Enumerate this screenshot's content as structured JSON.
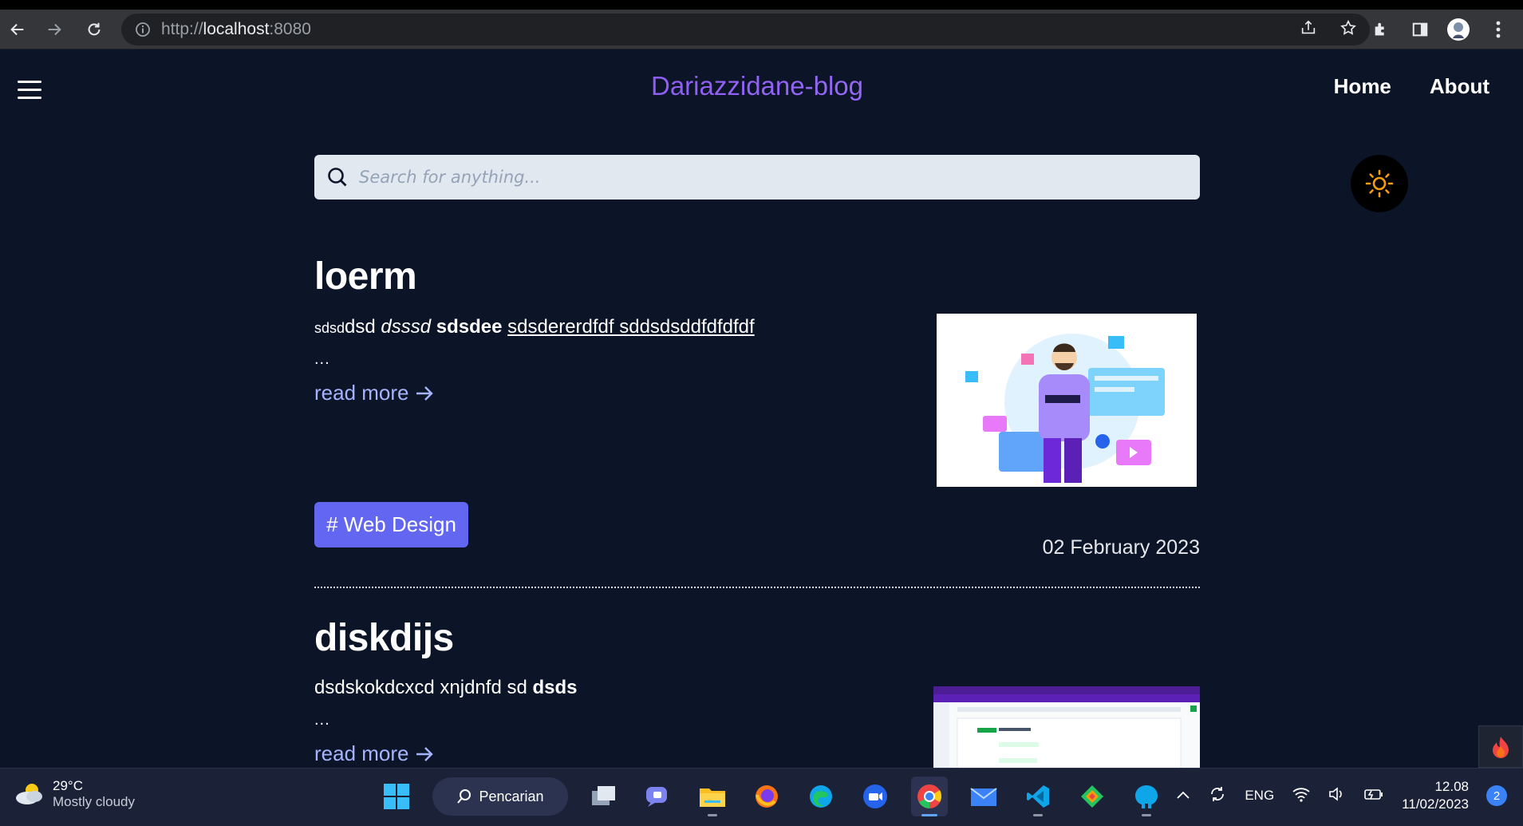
{
  "browser": {
    "url_host": "localhost",
    "url_prefix": "http://",
    "url_port": ":8080"
  },
  "site": {
    "brand": "Dariazzidane-blog",
    "nav": [
      "Home",
      "About"
    ],
    "search_placeholder": "Search for anything..."
  },
  "posts": [
    {
      "title": "loerm",
      "excerpt_small": "sdsd",
      "excerpt_plain": "dsd ",
      "excerpt_italic": "dsssd",
      "excerpt_bold": " sdsdee ",
      "excerpt_link": "sdsdererdfdf sddsdsddfdfdfdf",
      "ellipsis": "...",
      "read_more": "read more",
      "tag": "# Web Design",
      "date": "02 February 2023"
    },
    {
      "title": "diskdijs",
      "excerpt_plain": "dsdskokdcxcd xnjdnfd  sd ",
      "excerpt_bold": "dsds",
      "ellipsis": "...",
      "read_more": "read more"
    }
  ],
  "taskbar": {
    "weather_temp": "29°C",
    "weather_cond": "Mostly cloudy",
    "search_label": "Pencarian",
    "lang": "ENG",
    "time": "12.08",
    "date": "11/02/2023",
    "notifications": "2"
  },
  "colors": {
    "page_bg": "#0c1428",
    "brand": "#8b5cf6",
    "tag_bg": "#6366f1",
    "read_more": "#a5b4fc"
  }
}
